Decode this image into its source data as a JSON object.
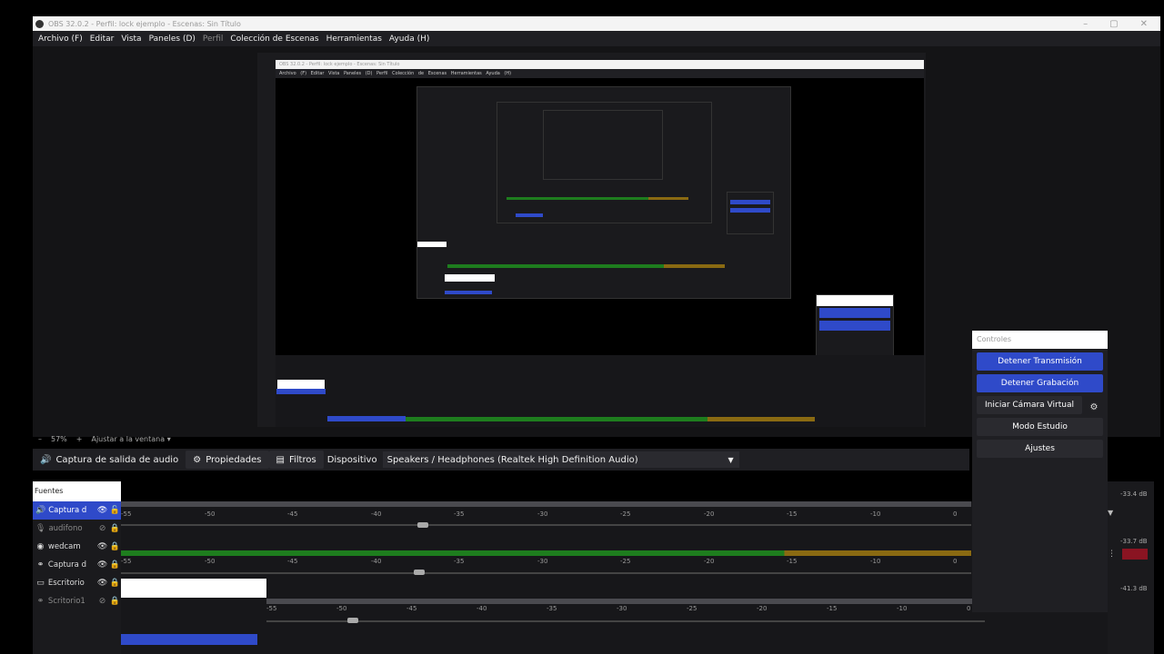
{
  "window": {
    "title": "OBS 32.0.2 - Perfil: lock ejemplo - Escenas: Sin Título",
    "controls": [
      "–",
      "▢",
      "✕"
    ]
  },
  "menu": [
    {
      "label": "Archivo (F)",
      "enabled": true
    },
    {
      "label": "Editar",
      "enabled": true
    },
    {
      "label": "Vista",
      "enabled": true
    },
    {
      "label": "Paneles (D)",
      "enabled": true
    },
    {
      "label": "Perfil",
      "enabled": false
    },
    {
      "label": "Colección de Escenas",
      "enabled": true
    },
    {
      "label": "Herramientas",
      "enabled": true
    },
    {
      "label": "Ayuda (H)",
      "enabled": true
    }
  ],
  "preview": {
    "nested_title": "OBS 32.0.2 - Perfil: lock ejemplo - Escenas: Sin Título",
    "nested_menu": "Archivo (F)  Editar  Vista  Paneles (D)  Perfil  Colección de Escenas  Herramientas  Ayuda (H)"
  },
  "zoom": {
    "minus": "–",
    "value": "57%",
    "plus": "+",
    "fit_label": "Ajustar a la ventana"
  },
  "source_toolbar": {
    "source_name": "Captura de salida de audio",
    "properties_label": "Propiedades",
    "filters_label": "Filtros",
    "device_label": "Dispositivo",
    "device_value": "Speakers / Headphones (Realtek High Definition Audio)"
  },
  "sources": {
    "header": "Fuentes",
    "items": [
      {
        "name": "Captura d",
        "icon": "speaker-icon",
        "glyph": "🔊",
        "visible": true,
        "locked": false,
        "selected": true,
        "dim": false
      },
      {
        "name": "audifono",
        "icon": "mic-icon",
        "glyph": "🎙",
        "visible": false,
        "locked": true,
        "selected": false,
        "dim": true
      },
      {
        "name": "wedcam",
        "icon": "camera-icon",
        "glyph": "◉",
        "visible": true,
        "locked": true,
        "selected": false,
        "dim": false
      },
      {
        "name": "Captura d",
        "icon": "link-icon",
        "glyph": "⚭",
        "visible": true,
        "locked": true,
        "selected": false,
        "dim": false
      },
      {
        "name": "Escritorio",
        "icon": "monitor-icon",
        "glyph": "▭",
        "visible": true,
        "locked": true,
        "selected": false,
        "dim": false
      },
      {
        "name": "Scritorio1",
        "icon": "link-icon",
        "glyph": "⚭",
        "visible": false,
        "locked": true,
        "selected": false,
        "dim": true
      }
    ]
  },
  "mixer": {
    "ticks": [
      "-55",
      "-50",
      "-45",
      "-40",
      "-35",
      "-30",
      "-25",
      "-20",
      "-15",
      "-10",
      "0"
    ],
    "db_values": [
      "-33.4 dB",
      "-33.7 dB",
      "-41.3 dB"
    ]
  },
  "controls": {
    "header": "Controles",
    "buttons": [
      {
        "label": "Detener Transmisión",
        "style": "blue"
      },
      {
        "label": "Detener Grabación",
        "style": "blue"
      },
      {
        "label": "Iniciar Cámara Virtual",
        "style": "normal"
      },
      {
        "label": "Modo Estudio",
        "style": "normal"
      },
      {
        "label": "Ajustes",
        "style": "normal"
      }
    ],
    "gear_icon": "⚙"
  },
  "colors": {
    "accent_blue": "#2f4ac9",
    "meter_green": "#1e7d1e",
    "meter_yellow": "#8a6a12",
    "meter_red": "#8a1422"
  }
}
